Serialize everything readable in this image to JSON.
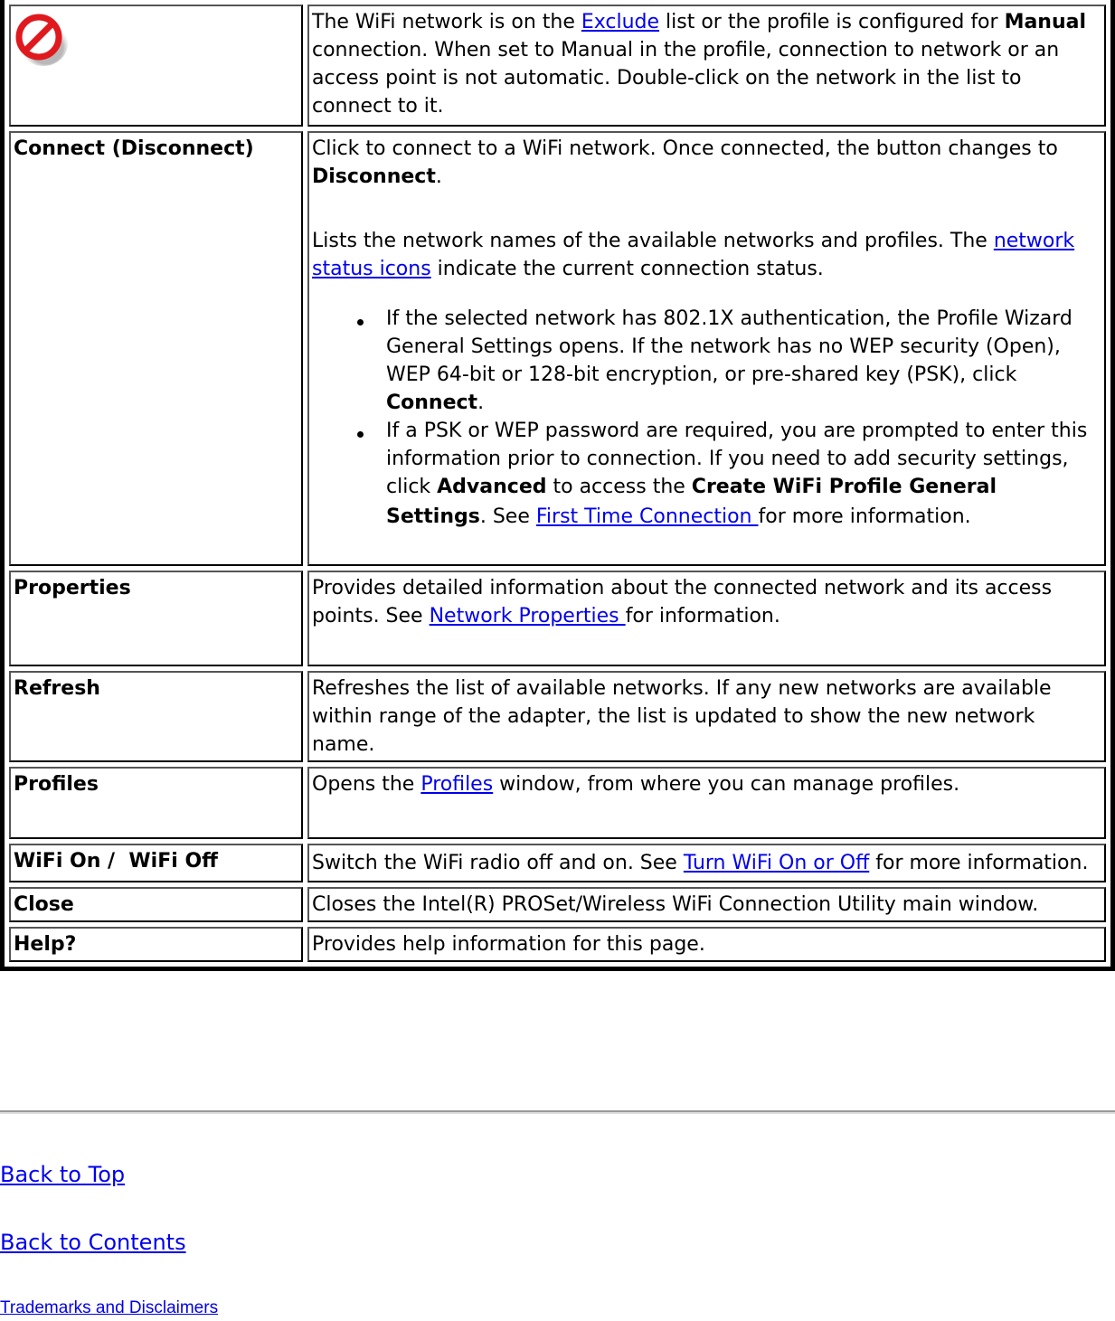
{
  "table": {
    "rows": [
      {
        "term_icon": "blocked-network-icon",
        "desc": {
          "p1_a": "The WiFi network is on the ",
          "p1_link": "Exclude",
          "p1_b": " list or the profile is configured for ",
          "p1_bold": "Manual",
          "p1_c": " connection. When set to Manual in the profile, connection to network or an access point is not automatic. Double-click on the network in the list to connect to it."
        }
      },
      {
        "term": "Connect (Disconnect)",
        "desc": {
          "p1_a": "Click to connect to a WiFi network. Once connected, the button changes to ",
          "p1_bold": "Disconnect",
          "p1_b": ".",
          "p2_a": "Lists the network names of the available networks and profiles. The ",
          "p2_link": "network status icons",
          "p2_b": " indicate the current connection status.",
          "bullets": [
            {
              "a": "If the selected network has 802.1X authentication, the Profile Wizard General Settings opens. If the network has no WEP security (Open), WEP 64-bit or 128-bit encryption, or pre-shared key (PSK), click ",
              "bold": "Connect",
              "b": "."
            },
            {
              "a": "If a PSK or WEP password are required, you are prompted to enter this information prior to connection. If you need to add security settings, click ",
              "bold1": "Advanced",
              "b": " to access the ",
              "bold2": "Create WiFi Profile General Settings",
              "c": ". See ",
              "link": "First Time Connection ",
              "d": "for more information."
            }
          ]
        }
      },
      {
        "term": "Properties",
        "desc": {
          "a": "Provides detailed information about the connected network and its access points. See ",
          "link": "Network Properties ",
          "b": "for information."
        }
      },
      {
        "term": "Refresh",
        "desc": {
          "a": "Refreshes the list of available networks. If any new networks are available within range of the adapter, the list is updated to show the new network name."
        }
      },
      {
        "term": "Profiles",
        "desc": {
          "a": "Opens the ",
          "link": "Profiles",
          "b": " window, from where you can manage profiles."
        }
      },
      {
        "term": "WiFi On /  WiFi Off",
        "desc": {
          "a": "Switch the WiFi radio off and on. See ",
          "link": "Turn WiFi On or Off",
          "b": " for more information."
        }
      },
      {
        "term": "Close",
        "desc": {
          "a": "Closes the Intel(R) PROSet/Wireless WiFi Connection Utility main window."
        }
      },
      {
        "term": "Help?",
        "desc": {
          "a": "Provides help information for this page."
        }
      }
    ]
  },
  "footer": {
    "back_to_top": "Back to Top",
    "back_to_contents": "Back to Contents",
    "trademarks": "Trademarks and Disclaimers"
  },
  "colors": {
    "link": "#0000ee",
    "icon_red": "#e0191e"
  }
}
